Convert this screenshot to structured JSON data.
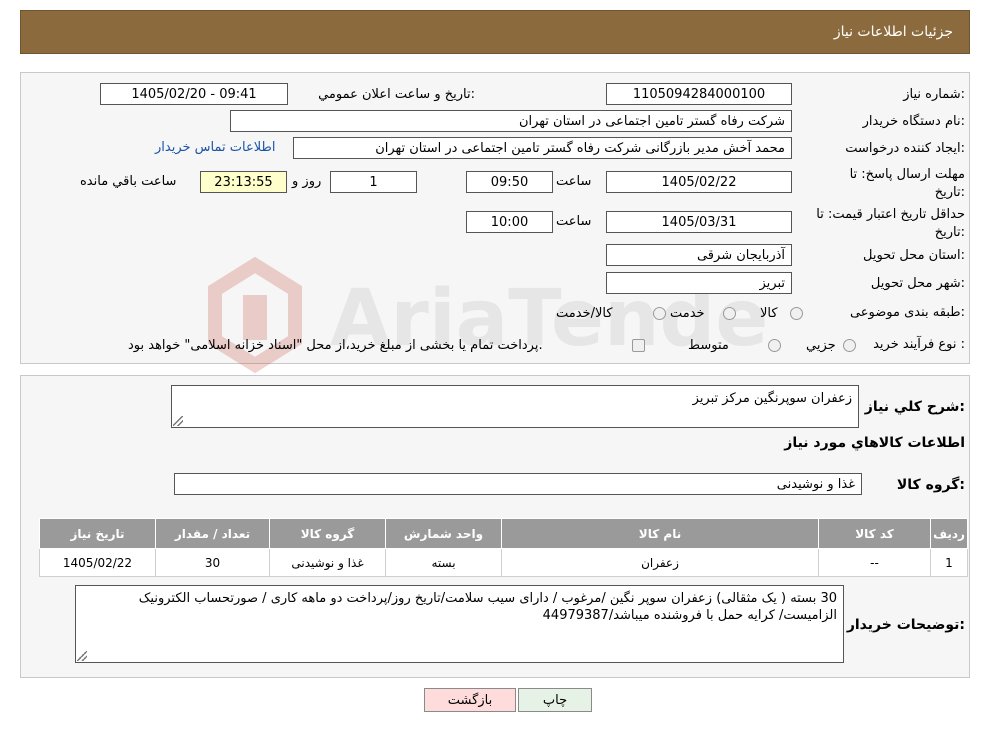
{
  "header": {
    "title": "جزئیات اطلاعات نیاز"
  },
  "form": {
    "need_number_label": "شماره نیاز:",
    "need_number": "1105094284000100",
    "announce_label": "تاریخ و ساعت اعلان عمومي:",
    "announce_value": "1405/02/20 - 09:41",
    "buyer_org_label": "نام دستگاه خریدار:",
    "buyer_org": "شرکت رفاه گستر تامین اجتماعی در استان تهران",
    "creator_label": "ایجاد کننده درخواست:",
    "creator": "محمد آخش مدیر بازرگانی شرکت رفاه گستر تامین اجتماعی در استان تهران",
    "contact_link": "اطلاعات تماس خریدار",
    "deadline_label_1": "مهلت ارسال پاسخ: تا",
    "deadline_label_2": "تاریخ:",
    "deadline_date": "1405/02/22",
    "time_label": "ساعت",
    "deadline_time": "09:50",
    "days_value": "1",
    "days_label": "روز و",
    "remaining_time": "23:13:55",
    "remaining_label": "ساعت باقي مانده",
    "validity_label_1": "حداقل تاریخ اعتبار قیمت: تا",
    "validity_label_2": "تاریخ:",
    "validity_date": "1405/03/31",
    "validity_time": "10:00",
    "province_label": "استان محل تحویل:",
    "province": "آذربایجان شرقی",
    "city_label": "شهر محل تحویل:",
    "city": "تبریز",
    "category_label": "طبقه بندی موضوعی:",
    "category_options": [
      "کالا",
      "خدمت",
      "کالا/خدمت"
    ],
    "process_label": "نوع فرآیند خرید :",
    "process_options": [
      "جزیي",
      "متوسط"
    ],
    "process_note": "پرداخت تمام یا بخشی از مبلغ خرید،از محل \"اسناد خزانه اسلامی\" خواهد بود."
  },
  "watermark": {
    "text": "AriaTender.neT"
  },
  "details": {
    "desc_label": "شرح کلي نیاز:",
    "desc_value": "زعفران سوپرنگین مرکز تبریز",
    "goods_info_title": "اطلاعات کالاهاي مورد نیاز",
    "goods_group_label": "گروه کالا:",
    "goods_group_value": "غذا و نوشیدنی",
    "table": {
      "headers": [
        "ردیف",
        "کد کالا",
        "نام کالا",
        "واحد شمارش",
        "گروه کالا",
        "تعداد / مقدار",
        "تاریخ نیاز"
      ],
      "rows": [
        [
          "1",
          "--",
          "زعفران",
          "بسته",
          "غذا و نوشیدنی",
          "30",
          "1405/02/22"
        ]
      ]
    },
    "buyer_notes_label": "توضیحات خریدار:",
    "buyer_notes": "30 بسته ( یک مثقالی) زعفران سوپر نگین /مرغوب / دارای سیب سلامت/تاریخ روز/پرداخت دو ماهه کاری / صورتحساب الکترونیک الزامیست/ کرایه حمل با فروشنده میباشد/44979387"
  },
  "buttons": {
    "print": "چاپ",
    "back": "بازگشت"
  },
  "colors": {
    "header_bg": "#8b6a3e",
    "back_btn_bg": "#ffdcdc",
    "print_btn_bg": "#e6f2e6",
    "link": "#1a54a8"
  }
}
